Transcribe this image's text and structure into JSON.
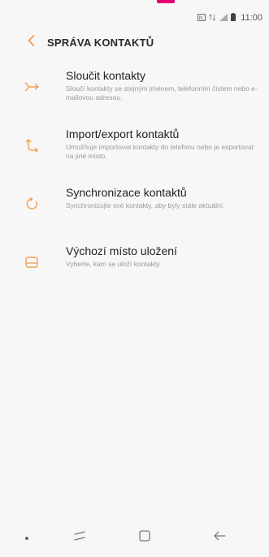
{
  "status": {
    "icons": [
      "nfc-icon",
      "data-icon",
      "signal-icon",
      "battery-icon"
    ],
    "time": "11:00",
    "carrier_color": "#e20074"
  },
  "header": {
    "back_icon": "chevron-left-icon",
    "title": "SPRÁVA KONTAKTŮ"
  },
  "accent_color": "#f0a050",
  "items": [
    {
      "icon": "merge-icon",
      "title": "Sloučit kontakty",
      "desc": "Sloučí kontakty se stejným jménem, telefonním číslem nebo e-mailovou adresou."
    },
    {
      "icon": "import-export-icon",
      "title": "Import/export kontaktů",
      "desc": "Umožňuje importovat kontakty do telefonu nebo je exportovat na jiné místo."
    },
    {
      "icon": "sync-icon",
      "title": "Synchronizace kontaktů",
      "desc": "Synchronizujte své kontakty, aby byly stále aktuální."
    },
    {
      "icon": "storage-icon",
      "title": "Výchozí místo uložení",
      "desc": "Vyberte, kam se uloží kontakty."
    }
  ],
  "navbar": {
    "buttons": [
      "dot-icon",
      "recents-icon",
      "home-icon",
      "back-arrow-icon"
    ]
  }
}
